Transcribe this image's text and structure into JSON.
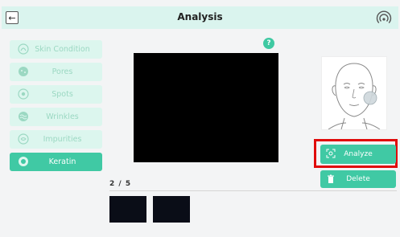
{
  "header": {
    "title": "Analysis",
    "back_symbol": "←"
  },
  "help": {
    "symbol": "?"
  },
  "sidebar": {
    "items": [
      {
        "label": "Skin Condition",
        "icon": "skin-condition-icon",
        "active": false
      },
      {
        "label": "Pores",
        "icon": "pores-icon",
        "active": false
      },
      {
        "label": "Spots",
        "icon": "spots-icon",
        "active": false
      },
      {
        "label": "Wrinkles",
        "icon": "wrinkles-icon",
        "active": false
      },
      {
        "label": "Impurities",
        "icon": "impurities-icon",
        "active": false
      },
      {
        "label": "Keratin",
        "icon": "keratin-icon",
        "active": true
      }
    ]
  },
  "actions": {
    "analyze_label": "Analyze",
    "delete_label": "Delete"
  },
  "gallery": {
    "counter": "2 / 5"
  },
  "colors": {
    "accent": "#40c9a4",
    "light_accent": "#dcf6ee",
    "highlight": "#e00b0b"
  }
}
